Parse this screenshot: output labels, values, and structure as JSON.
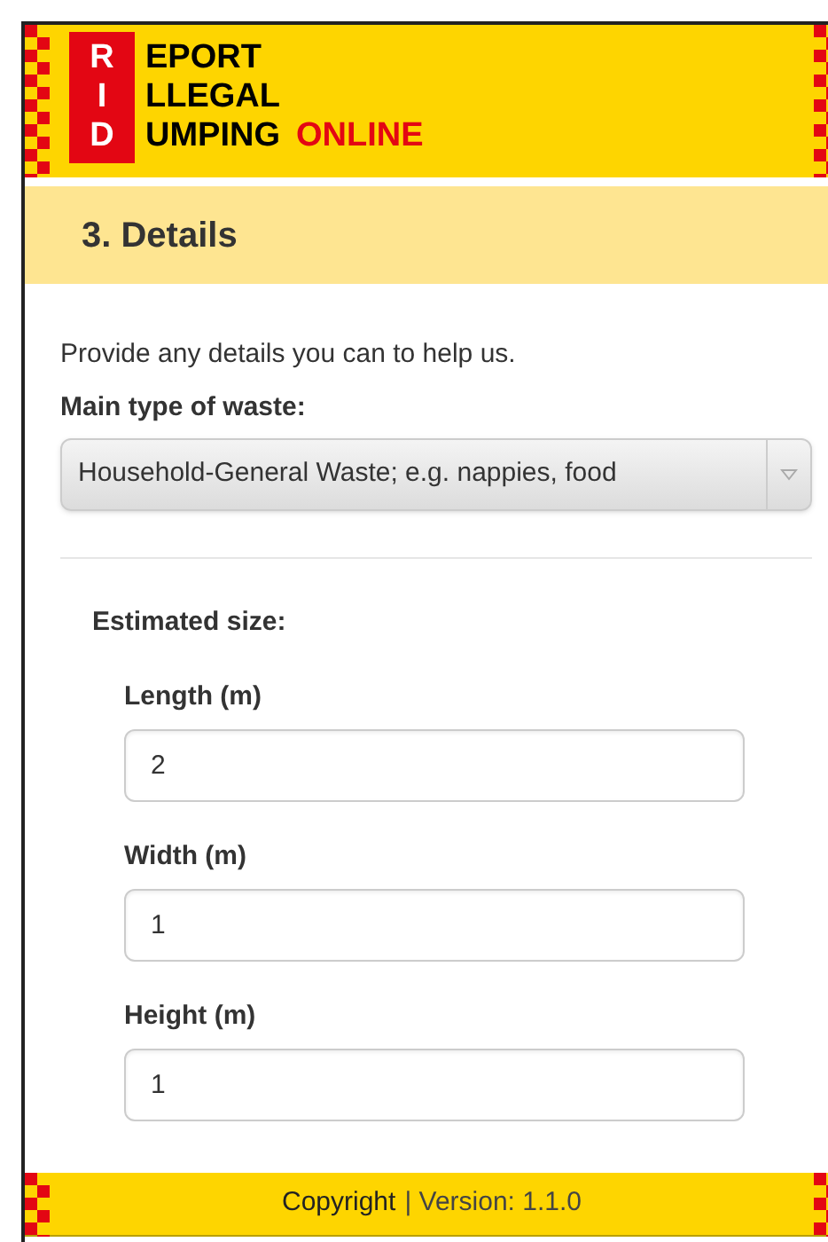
{
  "logo": {
    "letters": [
      "R",
      "I",
      "D"
    ],
    "words": [
      "EPORT",
      "LLEGAL",
      "UMPING"
    ],
    "suffix": "ONLINE"
  },
  "step_title": "3. Details",
  "intro": "Provide any details you can to help us.",
  "waste_type": {
    "label": "Main type of waste:",
    "value": "Household-General Waste; e.g. nappies, food"
  },
  "size": {
    "label": "Estimated size:",
    "fields": [
      {
        "label": "Length (m)",
        "value": "2"
      },
      {
        "label": "Width (m)",
        "value": "1"
      },
      {
        "label": "Height (m)",
        "value": "1"
      }
    ]
  },
  "footer": {
    "link": "Copyright",
    "text": "| Version: 1.1.0"
  }
}
